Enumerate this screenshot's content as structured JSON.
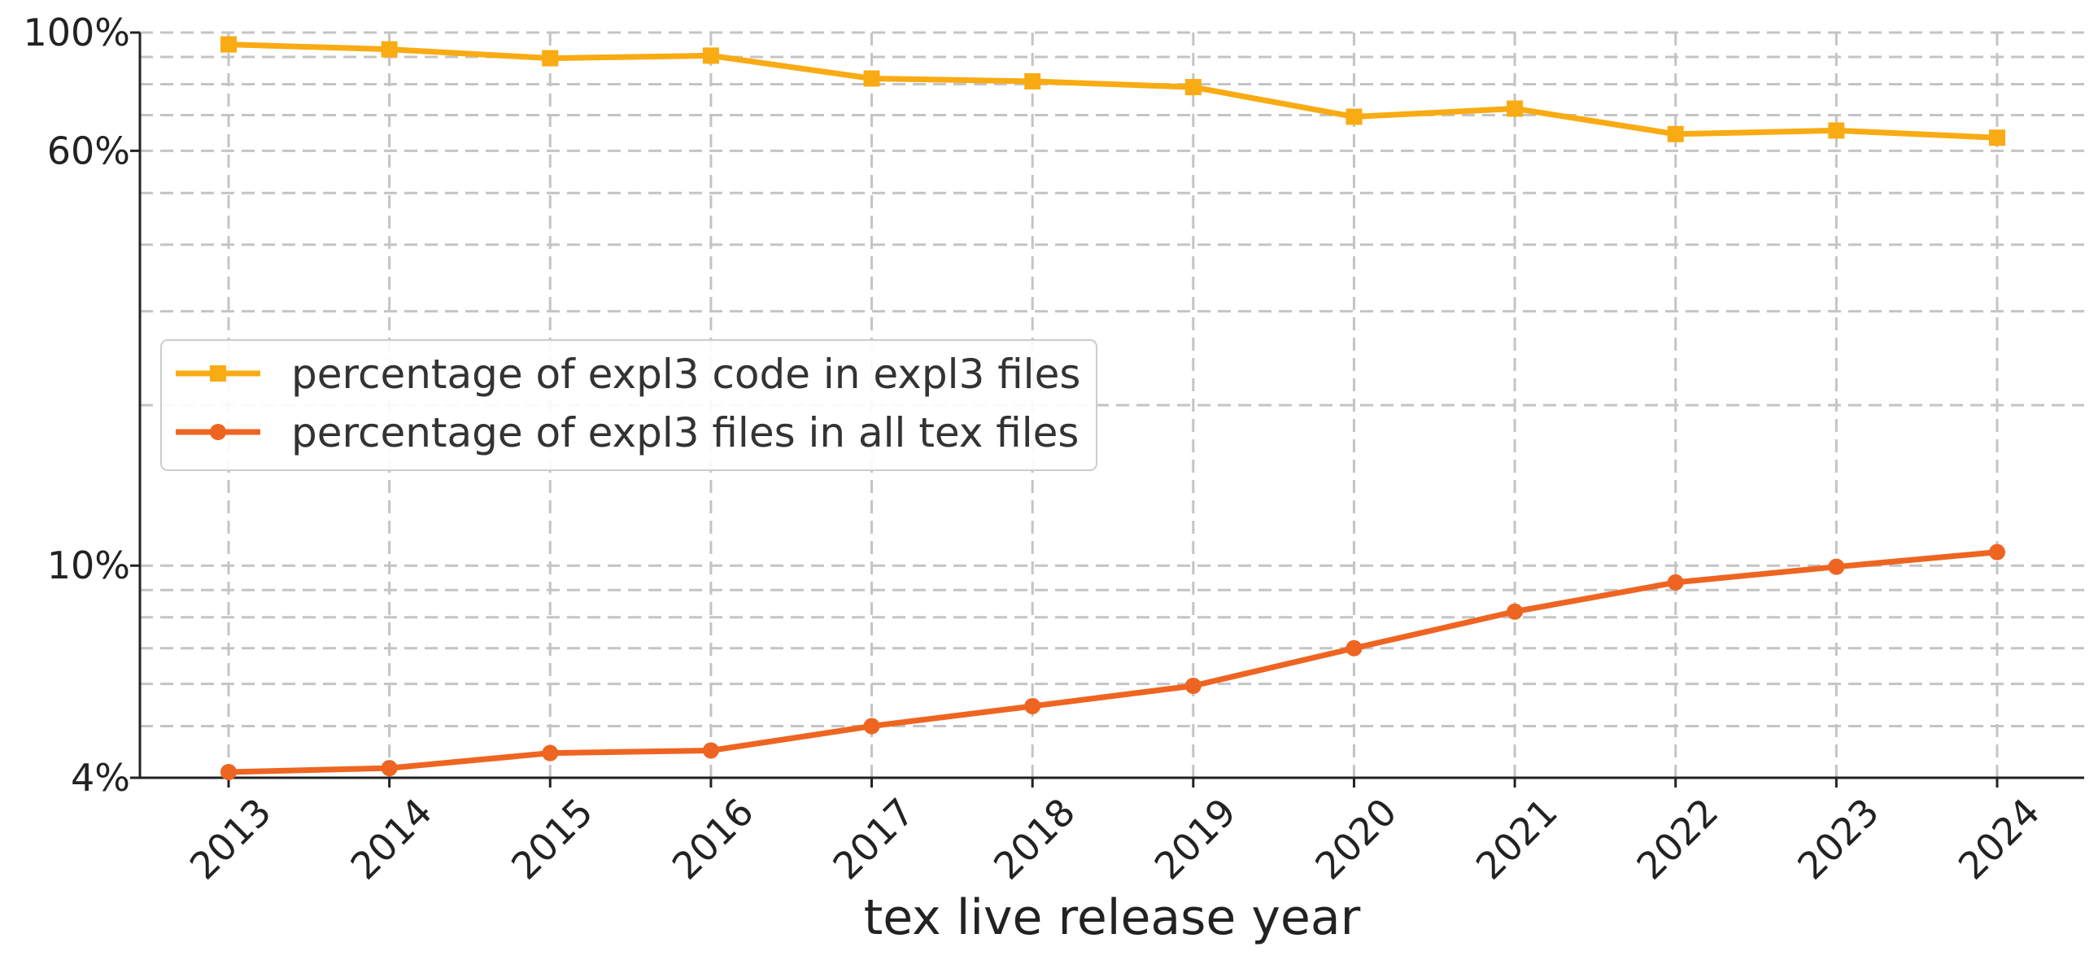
{
  "chart_data": {
    "type": "line",
    "title": "",
    "xlabel": "tex live release year",
    "ylabel": "",
    "y_scale": "log",
    "ylim": [
      4,
      100
    ],
    "y_ticks": [
      {
        "value": 100,
        "label": "100%"
      },
      {
        "value": 60,
        "label": "60%"
      },
      {
        "value": 10,
        "label": "10%"
      },
      {
        "value": 4,
        "label": "4%"
      }
    ],
    "grid": true,
    "legend_position": "center-left",
    "categories": [
      "2013",
      "2014",
      "2015",
      "2016",
      "2017",
      "2018",
      "2019",
      "2020",
      "2021",
      "2022",
      "2023",
      "2024"
    ],
    "series": [
      {
        "name": "percentage of expl3 code in expl3 files",
        "color": "#F9AB13",
        "marker": "square",
        "values": [
          95,
          93,
          89.5,
          90.5,
          82,
          81,
          79,
          69.5,
          72,
          64.5,
          65.5,
          63.5
        ]
      },
      {
        "name": "percentage of expl3 files in all tex files",
        "color": "#EE6522",
        "marker": "circle",
        "values": [
          4.1,
          4.17,
          4.45,
          4.5,
          5.0,
          5.45,
          5.95,
          7.0,
          8.2,
          9.3,
          9.95,
          10.6
        ]
      }
    ]
  }
}
